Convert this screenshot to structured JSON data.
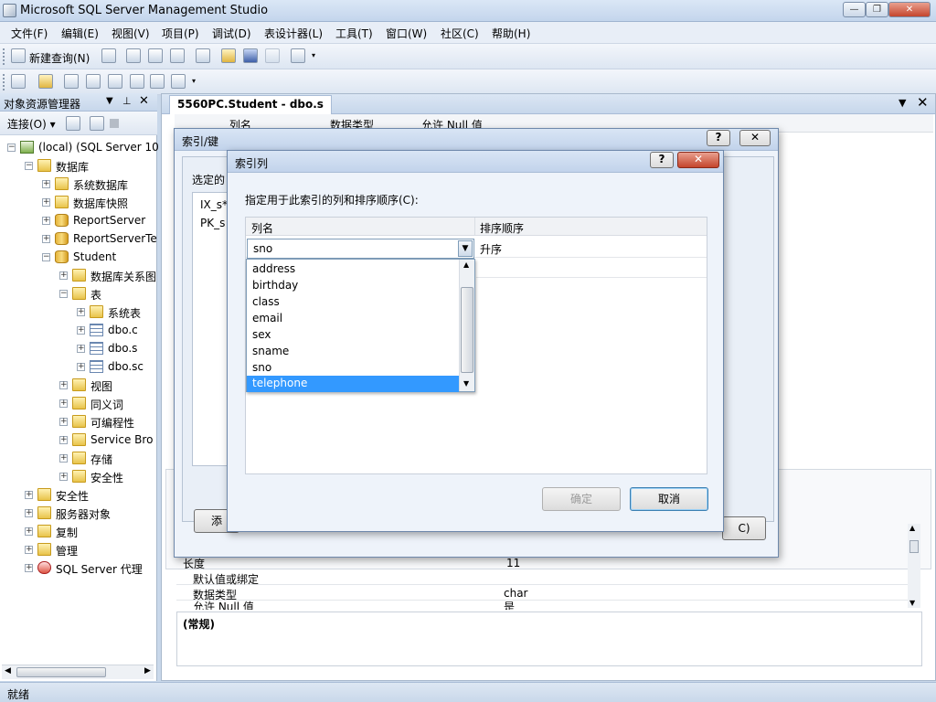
{
  "window": {
    "title": "Microsoft SQL Server Management Studio"
  },
  "menu": [
    "文件(F)",
    "编辑(E)",
    "视图(V)",
    "项目(P)",
    "调试(D)",
    "表设计器(L)",
    "工具(T)",
    "窗口(W)",
    "社区(C)",
    "帮助(H)"
  ],
  "toolbar": {
    "new_query": "新建查询(N)"
  },
  "object_explorer": {
    "title": "对象资源管理器",
    "connect": "连接(O)",
    "server": "(local) (SQL Server 10",
    "nodes": {
      "databases": "数据库",
      "system_dbs": "系统数据库",
      "snapshots": "数据库快照",
      "reportserver": "ReportServer",
      "reportservertemp": "ReportServerTe",
      "student": "Student",
      "diagrams": "数据库关系图",
      "tables": "表",
      "system_tables": "系统表",
      "t1": "dbo.c",
      "t2": "dbo.s",
      "t3": "dbo.sc",
      "views": "视图",
      "synonyms": "同义词",
      "programmability": "可编程性",
      "service_broker": "Service Bro",
      "storage": "存储",
      "security_db": "安全性",
      "security": "安全性",
      "server_objects": "服务器对象",
      "replication": "复制",
      "management": "管理",
      "agent": "SQL Server 代理"
    }
  },
  "document": {
    "tab": "5560PC.Student - dbo.s",
    "headers": [
      "列名",
      "数据类型",
      "允许 Null 值"
    ],
    "props": [
      {
        "name": "长度",
        "value": "11"
      },
      {
        "name": "默认值或绑定",
        "value": ""
      },
      {
        "name": "数据类型",
        "value": "char"
      },
      {
        "name": "允许 Null 值",
        "value": "是"
      }
    ],
    "general": "(常规)"
  },
  "index_dialog": {
    "title": "索引/键",
    "selected_label": "选定的",
    "items": [
      "IX_s*",
      "PK_s"
    ],
    "add_btn": "添",
    "close_btn": "C)"
  },
  "columns_dialog": {
    "title": "索引列",
    "instruction": "指定用于此索引的列和排序顺序(C):",
    "headers": [
      "列名",
      "排序顺序"
    ],
    "row": {
      "column": "sno",
      "order": "升序"
    },
    "dropdown_options": [
      "address",
      "birthday",
      "class",
      "email",
      "sex",
      "sname",
      "sno",
      "telephone"
    ],
    "selected_option": "telephone",
    "ok": "确定",
    "cancel": "取消"
  },
  "status": {
    "text": "就绪"
  }
}
